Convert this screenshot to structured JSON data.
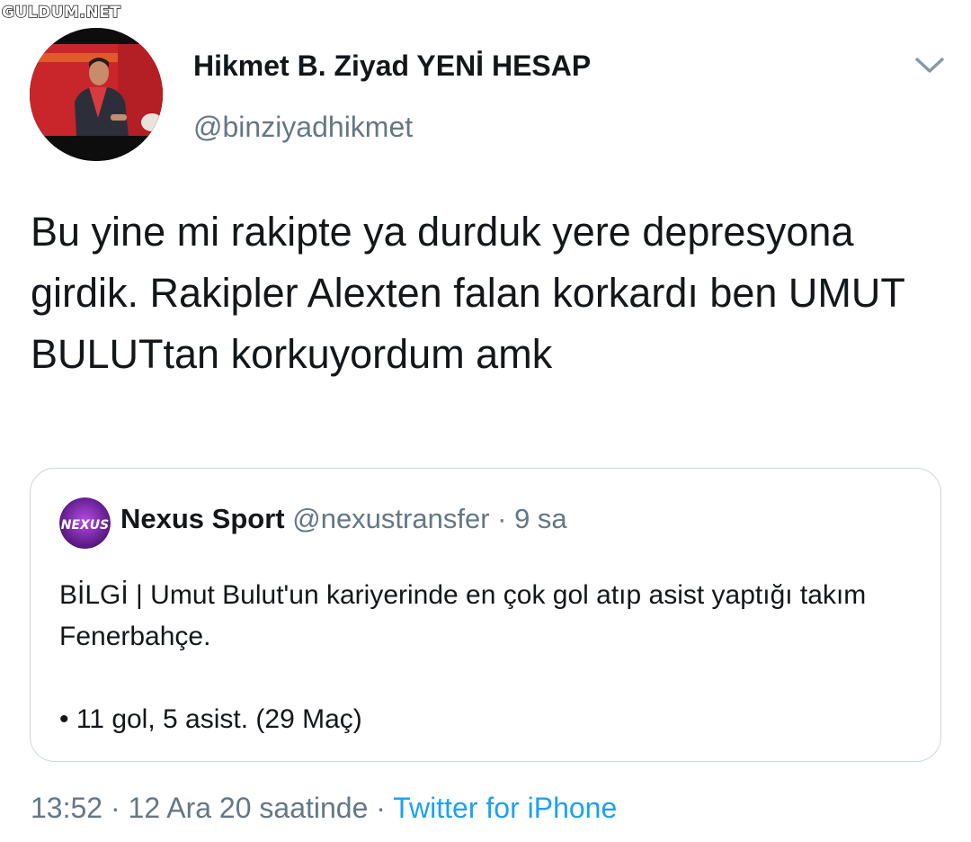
{
  "watermark": "GULDUM.NET",
  "author": {
    "name": "Hikmet B. Ziyad YENİ HESAP",
    "handle": "@binziyadhikmet"
  },
  "tweet": {
    "text": "Bu yine mi rakipte ya durduk yere depresyona girdik. Rakipler Alexten falan korkardı ben UMUT BULUTtan korkuyordum amk"
  },
  "quote": {
    "avatar_text": "NEXUS",
    "name": "Nexus Sport",
    "meta": "@nexustransfer · 9 sa",
    "body": "BİLGİ |  Umut Bulut'un kariyerinde en çok gol atıp asist yaptığı takım Fenerbahçe.",
    "stat": "• 11 gol, 5 asist. (29 Maç)"
  },
  "footer": {
    "meta": "13:52 · 12 Ara 20 saatinde · ",
    "source": "Twitter for iPhone"
  },
  "colors": {
    "text": "#14171a",
    "secondary": "#657786",
    "link": "#1da1f2",
    "border": "#ccd6dd"
  },
  "icons": {
    "menu": "chevron-down-icon"
  }
}
